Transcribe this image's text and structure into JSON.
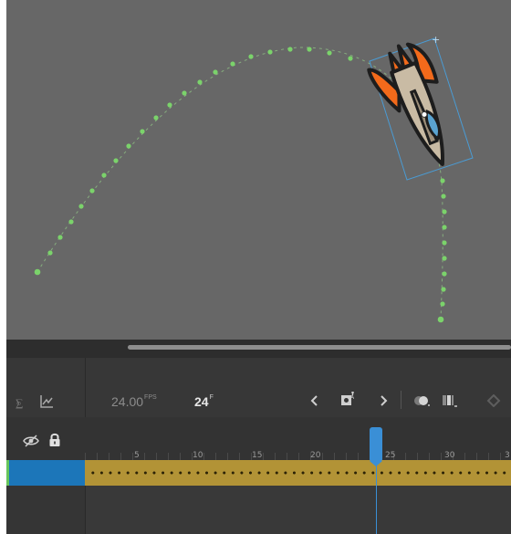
{
  "timeline": {
    "fps_value": "24.00",
    "fps_unit": "FPS",
    "current_frame": "24",
    "frame_unit": "F",
    "ruler_labels": [
      "5",
      "10",
      "15",
      "20",
      "25",
      "30",
      "3"
    ]
  },
  "icons": {
    "layer_parenting": "layer-parenting-icon",
    "graph": "graph-icon",
    "prev_keyframe": "chevron-left-icon",
    "insert_keyframe": "insert-keyframe-icon",
    "next_keyframe": "chevron-right-icon",
    "onion_skin": "onion-skin-icon",
    "edit_multiple_frames": "edit-multiple-frames-icon",
    "hide_layers": "eye-slash-icon",
    "lock_layers": "lock-icon"
  },
  "colors": {
    "stage_bg": "#676767",
    "motion_path_dots": "#7bd36b",
    "tween_span": "#b29336",
    "selected_layer": "#1c76b9",
    "playhead": "#3a8fd6",
    "rocket_orange": "#f26a1b",
    "rocket_body": "#c9bba4",
    "rocket_window": "#5aa3d0"
  }
}
